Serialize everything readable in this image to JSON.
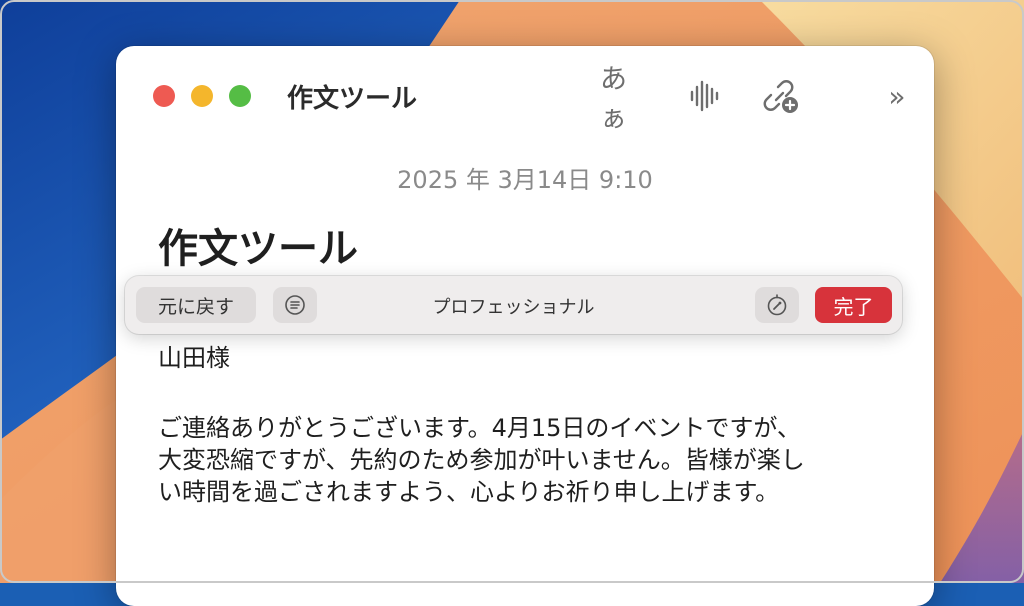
{
  "window": {
    "title": "作文ツール",
    "toolbar": {
      "font_label": "あぁ",
      "font_icon": "font-size-icon",
      "audio_icon": "waveform-icon",
      "link_icon": "link-add-icon",
      "more_icon": "chevron-double-right-icon",
      "more_label": "»"
    }
  },
  "note": {
    "date": "2025 年 3月14日 9:10",
    "title": "作文ツール",
    "salutation": "山田様",
    "body_lines": [
      "ご連絡ありがとうございます。4月15日のイベントですが、",
      "大変恐縮ですが、先約のため参加が叶いません。皆様が楽し",
      "い時間を過ごされますよう、心よりお祈り申し上げます。"
    ]
  },
  "writing_tools": {
    "revert_label": "元に戻す",
    "mode_label": "プロフェッショナル",
    "done_label": "完了",
    "summary_icon": "summary-list-icon",
    "rewrite_icon": "rewrite-compass-icon"
  },
  "colors": {
    "done_button": "#d7333b",
    "close": "#ee5a52",
    "minimize": "#f4b62c",
    "maximize": "#55bd45"
  }
}
